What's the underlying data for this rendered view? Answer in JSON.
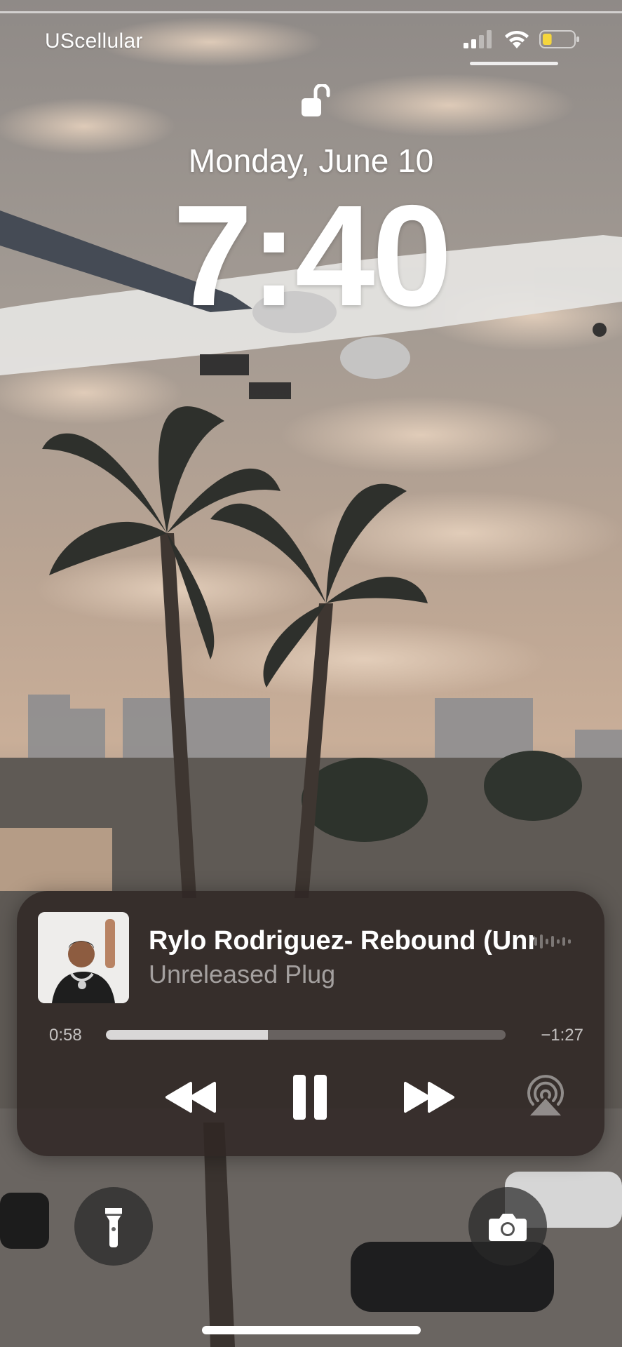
{
  "status_bar": {
    "carrier": "UScellular",
    "signal_bars_active": 2,
    "battery_level": 0.3,
    "battery_color": "#f5d63d"
  },
  "lock_screen": {
    "date": "Monday, June 10",
    "time": "7:40",
    "lock_state": "unlocked"
  },
  "now_playing": {
    "title": "Rylo Rodriguez- Rebound (Unreleased)",
    "artist": "Unreleased Plug",
    "elapsed": "0:58",
    "remaining": "−1:27",
    "progress": 0.405,
    "controls": [
      "rewind-icon",
      "pause-icon",
      "fast-forward-icon",
      "airplay-icon"
    ]
  },
  "quick_actions": [
    "flashlight-icon",
    "camera-icon"
  ],
  "colors": {
    "player_bg": "#30261f",
    "text": "#ffffff"
  }
}
